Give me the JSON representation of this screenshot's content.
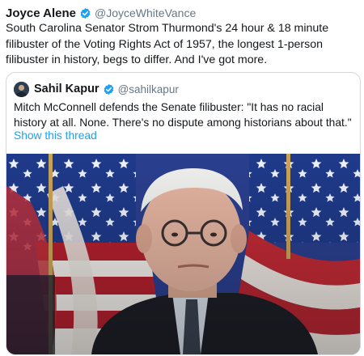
{
  "tweet": {
    "name": "Joyce Alene",
    "handle": "@JoyceWhiteVance",
    "text": "South Carolina Senator Strom Thurmond's 24 hour & 18 minute filibuster of the Voting Rights Act of 1957, the longest 1-person filibuster in history, begs to differ. And I've got more."
  },
  "quoted": {
    "name": "Sahil Kapur",
    "handle": "@sahilkapur",
    "text": "Mitch McConnell defends the Senate filibuster: \"It has no racial history at all. None. There's no dispute among historians about that.\"",
    "thread_link": "Show this thread"
  },
  "icons": {
    "verified": "verified-badge-icon",
    "avatar": "avatar"
  },
  "colors": {
    "accent": "#1da1f2",
    "handle": "#657786",
    "text": "#14171a",
    "border": "#cfd9de"
  }
}
